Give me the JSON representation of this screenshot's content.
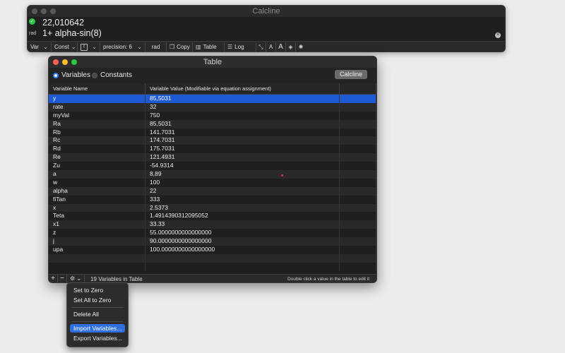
{
  "calcline": {
    "title": "Calcline",
    "result": "22,010642",
    "angle_mode": "rad",
    "expression": "1+ alpha-sin(8)",
    "toolbar": {
      "var": "Var",
      "const": "Const",
      "fx": "fx",
      "precision": "precision: 6",
      "rad": "rad",
      "copy": "Copy",
      "table": "Table",
      "log": "Log",
      "a_small": "A",
      "a_large": "A"
    }
  },
  "table_window": {
    "title": "Table",
    "radio_variables": "Variables",
    "radio_constants": "Constants",
    "calcline_button": "Calcline",
    "col_name": "Variable Name",
    "col_value": "Variable Value (Modifiable via equation assignment)",
    "rows": [
      {
        "name": "y",
        "value": "85,5031"
      },
      {
        "name": "rate",
        "value": "32"
      },
      {
        "name": "myVal",
        "value": "750"
      },
      {
        "name": "Ra",
        "value": "85,5031"
      },
      {
        "name": "Rb",
        "value": "141.7031"
      },
      {
        "name": "Rc",
        "value": "174.7031"
      },
      {
        "name": "Rd",
        "value": "175.7031"
      },
      {
        "name": "Re",
        "value": "121.4931"
      },
      {
        "name": "Zu",
        "value": "-54.9314"
      },
      {
        "name": "a",
        "value": "8,89"
      },
      {
        "name": "w",
        "value": "100"
      },
      {
        "name": "alpha",
        "value": "22"
      },
      {
        "name": "fiTan",
        "value": "333"
      },
      {
        "name": "x",
        "value": "2.5373"
      },
      {
        "name": "Teta",
        "value": "1.4914390312095052"
      },
      {
        "name": "x1",
        "value": "33.33"
      },
      {
        "name": "z",
        "value": "55.0000000000000000"
      },
      {
        "name": "j",
        "value": "90.0000000000000000"
      },
      {
        "name": "upa",
        "value": "100.0000000000000000"
      }
    ],
    "footer_plus": "+",
    "footer_minus": "−",
    "footer_count": "19 Variables in Table",
    "footer_hint": "Double click a value in the table to edit it"
  },
  "menu": {
    "set_zero": "Set to Zero",
    "set_all_zero": "Set All to Zero",
    "delete_all": "Delete All",
    "import": "Import Variables...",
    "export": "Export Variables..."
  },
  "colors": {
    "selection": "#1f5ad6",
    "menu_highlight": "#2f6fe0",
    "ok_green": "#28c840"
  }
}
